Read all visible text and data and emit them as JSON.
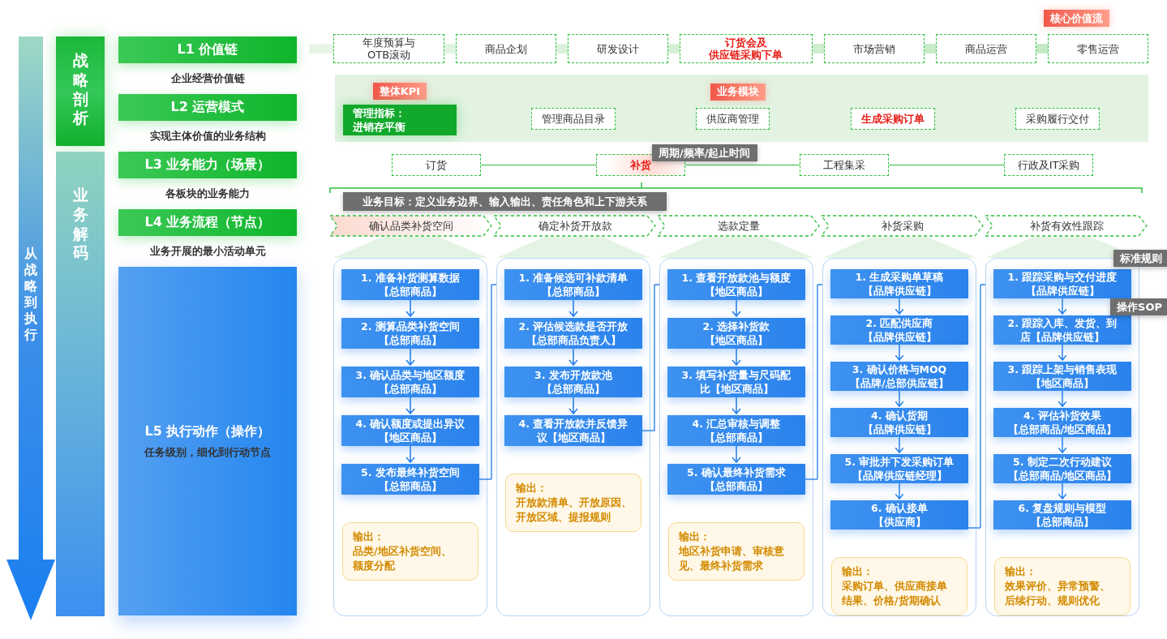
{
  "side_arrow": {
    "label": "从战略到执行"
  },
  "phases": [
    {
      "label": "战略剖析",
      "kind": "strategy"
    },
    {
      "label": "业务解码",
      "kind": "decode"
    }
  ],
  "levels": [
    {
      "title": "L1 价值链",
      "caption": "企业经营价值链",
      "kind": "green"
    },
    {
      "title": "L2 运营模式",
      "caption": "实现主体价值的业务结构",
      "kind": "green"
    },
    {
      "title": "L3 业务能力（场景）",
      "caption": "各板块的业务能力",
      "kind": "green"
    },
    {
      "title": "L4 业务流程（节点）",
      "caption": "业务开展的最小活动单元",
      "kind": "green"
    },
    {
      "title": "L5 执行动作（操作）",
      "caption": "任务级别，细化到行动节点",
      "kind": "blue"
    }
  ],
  "value_chain": {
    "tag": "核心价值流",
    "items": [
      {
        "lines": [
          "年度预算与",
          "OTB滚动"
        ],
        "highlight": false
      },
      {
        "lines": [
          "商品企划"
        ],
        "highlight": false
      },
      {
        "lines": [
          "研发设计"
        ],
        "highlight": false
      },
      {
        "lines": [
          "订货会及",
          "供应链采购下单"
        ],
        "highlight": true
      },
      {
        "lines": [
          "市场营销"
        ],
        "highlight": false
      },
      {
        "lines": [
          "商品运营"
        ],
        "highlight": false
      },
      {
        "lines": [
          "零售运营"
        ],
        "highlight": false
      }
    ]
  },
  "operation_model": {
    "kpi_tag": "整体KPI",
    "kpi": [
      "管理指标：",
      "进销存平衡"
    ],
    "module_tag": "业务模块",
    "modules": [
      {
        "label": "管理商品目录",
        "highlight": false
      },
      {
        "label": "供应商管理",
        "highlight": false
      },
      {
        "label": "生成采购订单",
        "highlight": true
      },
      {
        "label": "采购履行交付",
        "highlight": false
      }
    ]
  },
  "capabilities": {
    "tag": "周期/频率/起止时间",
    "items": [
      {
        "label": "订货",
        "selected": false
      },
      {
        "label": "补货",
        "selected": true
      },
      {
        "label": "工程集采",
        "selected": false
      },
      {
        "label": "行政及IT采购",
        "selected": false
      }
    ]
  },
  "process": {
    "goal": "业务目标：定义业务边界、输入输出、责任角色和上下游关系",
    "steps": [
      {
        "label": "确认品类补货空间",
        "selected": true
      },
      {
        "label": "确定补货开放款",
        "selected": false
      },
      {
        "label": "选款定量",
        "selected": false
      },
      {
        "label": "补货采购",
        "selected": false
      },
      {
        "label": "补货有效性跟踪",
        "selected": false
      }
    ]
  },
  "actions": {
    "tags": [
      "标准规则",
      "操作SOP"
    ],
    "columns": [
      {
        "steps": [
          [
            "1. 准备补货测算数据",
            "【总部商品】"
          ],
          [
            "2. 测算品类补货空间",
            "【总部商品】"
          ],
          [
            "3. 确认品类与地区额度",
            "【总部商品】"
          ],
          [
            "4. 确认额度或提出异议",
            "【地区商品】"
          ],
          [
            "5. 发布最终补货空间",
            "【总部商品】"
          ]
        ],
        "output": [
          "输出：",
          "品类/地区补货空间、",
          "额度分配"
        ]
      },
      {
        "steps": [
          [
            "1. 准备候选可补款清单",
            "【总部商品】"
          ],
          [
            "2. 评估候选款是否开放",
            "【总部商品负责人】"
          ],
          [
            "3. 发布开放款池",
            "【总部商品】"
          ],
          [
            "4. 查看开放款并反馈异",
            "议【地区商品】"
          ]
        ],
        "output": [
          "输出：",
          "开放款清单、开放原因、",
          "开放区域、提报规则"
        ]
      },
      {
        "steps": [
          [
            "1. 查看开放款池与额度",
            "【地区商品】"
          ],
          [
            "2. 选择补货款",
            "【地区商品】"
          ],
          [
            "3. 填写补货量与尺码配",
            "比【地区商品】"
          ],
          [
            "4. 汇总审核与调整",
            "【总部商品】"
          ],
          [
            "5. 确认最终补货需求",
            "【总部商品】"
          ]
        ],
        "output": [
          "输出：",
          "地区补货申请、审核意",
          "见、最终补货需求"
        ]
      },
      {
        "steps": [
          [
            "1. 生成采购单草稿",
            "【品牌供应链】"
          ],
          [
            "2. 匹配供应商",
            "【品牌供应链】"
          ],
          [
            "3. 确认价格与MOQ",
            "【品牌/总部供应链】"
          ],
          [
            "4. 确认货期",
            "【品牌供应链】"
          ],
          [
            "5. 审批并下发采购订单",
            "【品牌供应链经理】"
          ],
          [
            "6. 确认接单",
            "【供应商】"
          ]
        ],
        "output": [
          "输出：",
          "采购订单、供应商接单",
          "结果、价格/货期确认"
        ]
      },
      {
        "steps": [
          [
            "1. 跟踪采购与交付进度",
            "【品牌供应链】"
          ],
          [
            "2. 跟踪入库、发货、到",
            "店【品牌供应链】"
          ],
          [
            "3. 跟踪上架与销售表现",
            "【地区商品】"
          ],
          [
            "4. 评估补货效果",
            "【总部商品/地区商品】"
          ],
          [
            "5. 制定二次行动建议",
            "【总部商品/地区商品】"
          ],
          [
            "6. 复盘规则与模型",
            "【总部商品】"
          ]
        ],
        "output": [
          "输出：",
          "效果评价、异常预警、",
          "后续行动、规则优化"
        ]
      }
    ]
  }
}
